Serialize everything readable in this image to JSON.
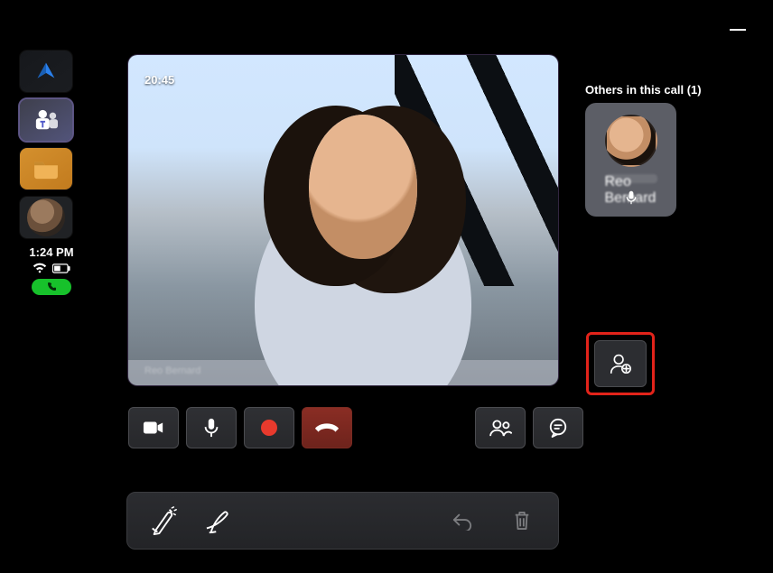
{
  "sidebar": {
    "app1_icon": "realwear-logo-icon",
    "app2_icon": "teams-icon",
    "app3_icon": "folder-icon",
    "avatar_icon": "user-avatar-icon",
    "clock": "1:24 PM",
    "wifi_icon": "wifi-icon",
    "battery_icon": "battery-icon",
    "call_pill_icon": "phone-icon"
  },
  "video": {
    "timer": "20:45",
    "caption_name": "Reo Bernard"
  },
  "participants": {
    "header": "Others in this call (1)",
    "tile": {
      "name": "Reo Bernard",
      "mic_icon": "mic-icon"
    }
  },
  "add_person": {
    "icon": "add-person-icon"
  },
  "controls": {
    "camera": "camera-icon",
    "mic": "mic-icon",
    "record": "record-icon",
    "end": "hangup-icon",
    "people": "people-icon",
    "chat": "chat-icon"
  },
  "bottombar": {
    "pen_fancy": "pen-highlight-icon",
    "pen": "pen-icon",
    "undo": "undo-icon",
    "trash": "trash-icon"
  },
  "window": {
    "minimize_icon": "minimize-icon"
  }
}
